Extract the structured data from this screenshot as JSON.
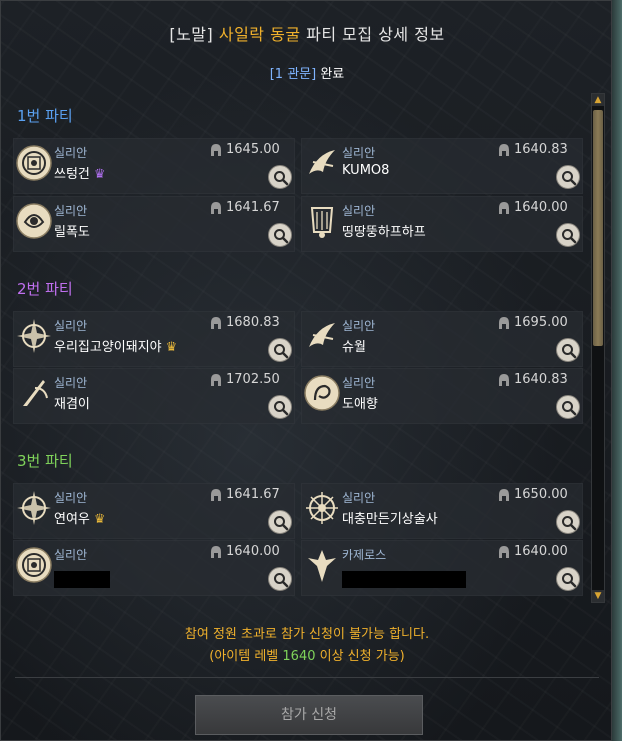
{
  "dialog": {
    "title_prefix": "[노말]",
    "title_highlight": "사일락 동굴",
    "title_suffix": "파티 모집 상세 정보",
    "subtitle_bracket": "[1 관문]",
    "subtitle_status": "완료"
  },
  "parties": [
    {
      "label": "1번 파티",
      "color": "#5aa0f0",
      "members": [
        {
          "server": "실리안",
          "name": "쓰텅건",
          "ilvl": "1645.00",
          "leader": true,
          "crown_color": "#b070f0",
          "icon": "artillerist-class-icon"
        },
        {
          "server": "실리안",
          "name": "KUMO8",
          "ilvl": "1640.83",
          "leader": false,
          "icon": "deathblade-class-icon"
        },
        {
          "server": "실리안",
          "name": "릴폭도",
          "ilvl": "1641.67",
          "leader": false,
          "icon": "sorceress-class-icon"
        },
        {
          "server": "실리안",
          "name": "띵땅뚱하프하프",
          "ilvl": "1640.00",
          "leader": false,
          "icon": "bard-class-icon"
        }
      ]
    },
    {
      "label": "2번 파티",
      "color": "#c070f0",
      "members": [
        {
          "server": "실리안",
          "name": "우리집고양이돼지야",
          "ilvl": "1680.83",
          "leader": true,
          "crown_color": "#e8b83a",
          "icon": "striker-class-icon"
        },
        {
          "server": "실리안",
          "name": "슈월",
          "ilvl": "1695.00",
          "leader": false,
          "icon": "deathblade-class-icon"
        },
        {
          "server": "실리안",
          "name": "재겸이",
          "ilvl": "1702.50",
          "leader": false,
          "icon": "reaper-class-icon"
        },
        {
          "server": "실리안",
          "name": "도애향",
          "ilvl": "1640.83",
          "leader": false,
          "icon": "artist-class-icon"
        }
      ]
    },
    {
      "label": "3번 파티",
      "color": "#7fd35a",
      "members": [
        {
          "server": "실리안",
          "name": "연여우",
          "ilvl": "1641.67",
          "leader": true,
          "crown_color": "#e8b83a",
          "icon": "striker-class-icon"
        },
        {
          "server": "실리안",
          "name": "대충만든기상술사",
          "ilvl": "1650.00",
          "leader": false,
          "icon": "aeromancer-class-icon"
        },
        {
          "server": "실리안",
          "name": "",
          "ilvl": "1640.00",
          "leader": false,
          "redacted": true,
          "icon": "artillerist-class-icon"
        },
        {
          "server": "카제로스",
          "name": "",
          "ilvl": "1640.00",
          "leader": false,
          "redacted": true,
          "icon": "paladin-class-icon"
        }
      ]
    }
  ],
  "notice": {
    "line1": "참여 정원 초과로 참가 신청이 불가능 합니다.",
    "line2_prefix": "(아이템 레벨 ",
    "line2_level": "1640",
    "line2_suffix": " 이상 신청 가능)"
  },
  "apply_button_label": "참가 신청",
  "crown_symbol": "♛"
}
